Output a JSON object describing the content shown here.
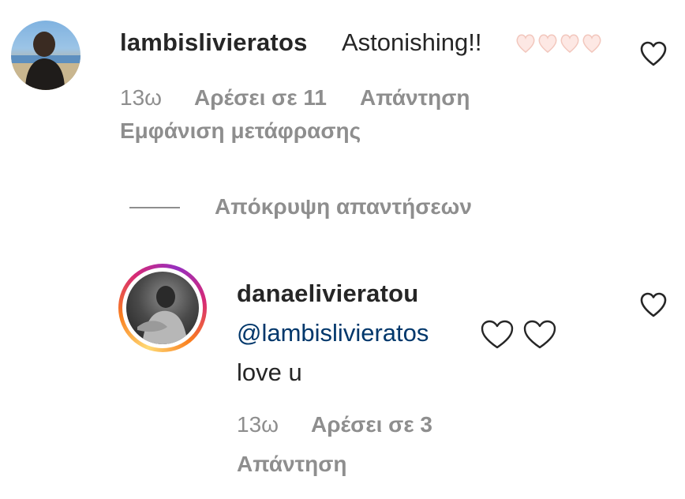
{
  "comments": [
    {
      "username": "lambislivieratos",
      "text": "Astonishing!!",
      "emoji_icon": "pink-hearts-emoji",
      "time": "13ω",
      "likes": "Αρέσει σε 11",
      "reply": "Απάντηση",
      "translate": "Εμφάνιση μετάφρασης"
    },
    {
      "username": "danaelivieratou",
      "mention": "@lambislivieratos",
      "emoji_icon": "white-hearts-emoji",
      "text": "love u",
      "time": "13ω",
      "likes": "Αρέσει σε 3",
      "reply": "Απάντηση"
    }
  ],
  "replies_toggle": "Απόκρυψη απαντήσεων",
  "colors": {
    "meta": "#8e8e8e",
    "mention": "#00376b",
    "text": "#262626"
  }
}
